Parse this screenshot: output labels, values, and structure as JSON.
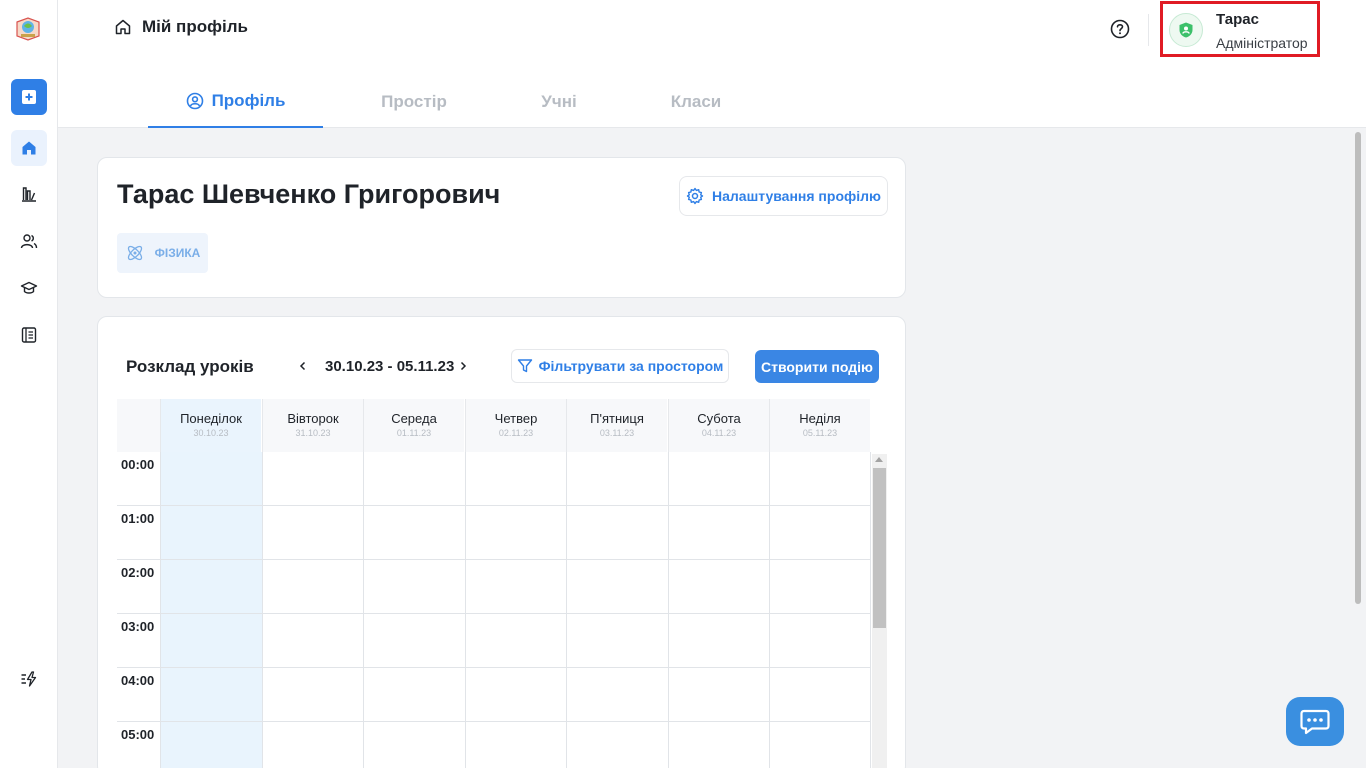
{
  "header": {
    "breadcrumb": "Мій профіль",
    "user": {
      "name": "Тарас",
      "role": "Адміністратор"
    }
  },
  "sidebar": {
    "items": [
      {
        "icon": "plus-square-icon"
      },
      {
        "icon": "home-icon",
        "active": true
      },
      {
        "icon": "stats-icon"
      },
      {
        "icon": "users-icon"
      },
      {
        "icon": "graduation-cap-icon"
      },
      {
        "icon": "book-icon"
      },
      {
        "icon": "lightning-icon"
      }
    ]
  },
  "tabs": [
    {
      "label": "Профіль",
      "active": true
    },
    {
      "label": "Простір"
    },
    {
      "label": "Учні"
    },
    {
      "label": "Класи"
    }
  ],
  "profile": {
    "full_name": "Тарас Шевченко Григорович",
    "settings_label": "Налаштування профілю",
    "subject": "ФІЗИКА"
  },
  "schedule": {
    "title": "Розклад уроків",
    "date_range": "30.10.23 - 05.11.23",
    "filter_label": "Фільтрувати за простором",
    "create_label": "Створити подію",
    "days": [
      {
        "name": "Понеділок",
        "date": "30.10.23",
        "today": true
      },
      {
        "name": "Вівторок",
        "date": "31.10.23"
      },
      {
        "name": "Середа",
        "date": "01.11.23"
      },
      {
        "name": "Четвер",
        "date": "02.11.23"
      },
      {
        "name": "П'ятниця",
        "date": "03.11.23"
      },
      {
        "name": "Субота",
        "date": "04.11.23"
      },
      {
        "name": "Неділя",
        "date": "05.11.23"
      }
    ],
    "hours": [
      "00:00",
      "01:00",
      "02:00",
      "03:00",
      "04:00",
      "05:00"
    ]
  },
  "colors": {
    "accent": "#2f7fe6",
    "highlight_border": "#e01b24",
    "avatar_green": "#3cc06a"
  }
}
